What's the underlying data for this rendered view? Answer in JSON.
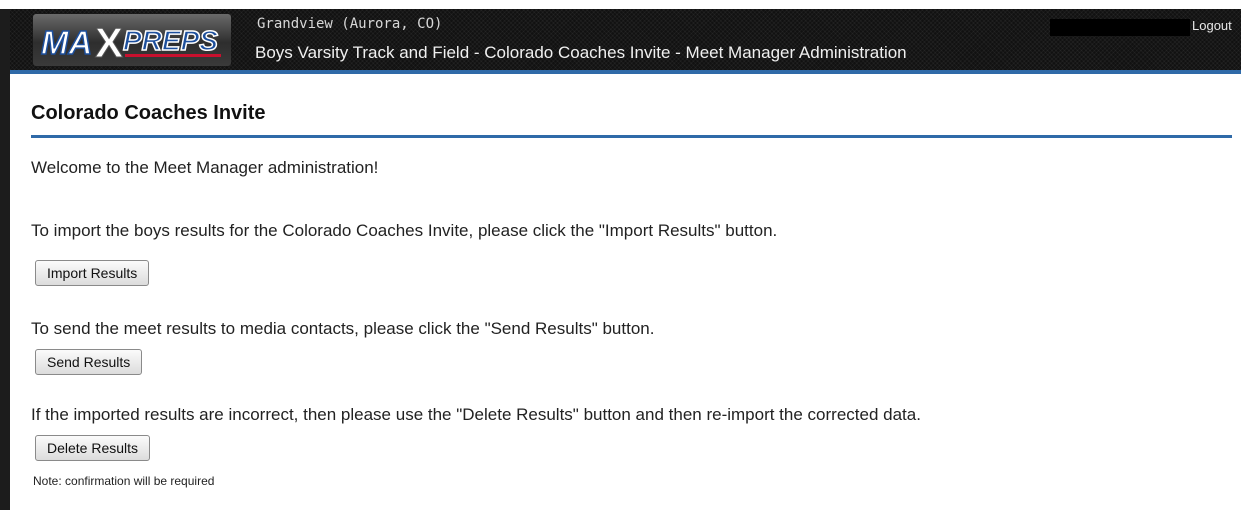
{
  "header": {
    "logo_text": "MAXPREPS",
    "school": "Grandview (Aurora, CO)",
    "subtitle": "Boys Varsity Track and Field - Colorado Coaches Invite - Meet Manager Administration",
    "logout_label": "Logout"
  },
  "main": {
    "title": "Colorado Coaches Invite",
    "welcome": "Welcome to the Meet Manager administration!",
    "import_text": "To import the boys results for the Colorado Coaches Invite, please click the \"Import Results\" button.",
    "import_button": "Import Results",
    "send_text": "To send the meet results to media contacts, please click the \"Send Results\" button.",
    "send_button": "Send Results",
    "delete_text": "If the imported results are incorrect, then please use the \"Delete Results\" button and then re-import the corrected data.",
    "delete_button": "Delete Results",
    "note": "Note: confirmation will be required"
  },
  "colors": {
    "accent": "#2f6aa8",
    "header_bg": "#111111",
    "logo_red": "#c8102e",
    "logo_blue": "#1d4f9c"
  }
}
